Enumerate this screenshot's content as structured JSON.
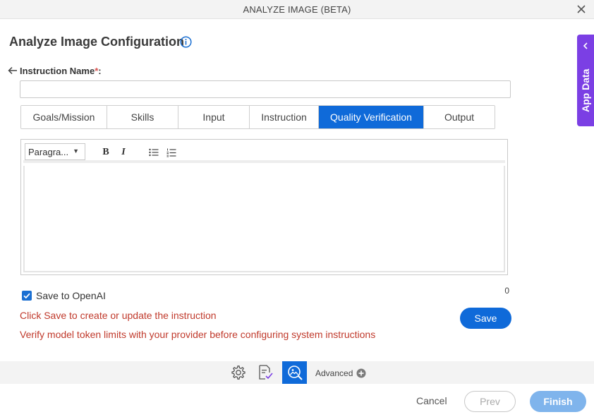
{
  "window": {
    "title": "ANALYZE IMAGE (BETA)"
  },
  "page": {
    "heading": "Analyze Image Configuration"
  },
  "form": {
    "instruction_label": "Instruction Name",
    "required_mark": "*",
    "label_suffix": ":",
    "instruction_value": ""
  },
  "tabs": [
    {
      "label": "Goals/Mission"
    },
    {
      "label": "Skills"
    },
    {
      "label": "Input"
    },
    {
      "label": "Instruction"
    },
    {
      "label": "Quality Verification",
      "active": true
    },
    {
      "label": "Output"
    }
  ],
  "editor": {
    "paragraph_select": "Paragra...",
    "bold": "B",
    "italic": "I",
    "char_count": "0"
  },
  "options": {
    "save_to_openai_label": "Save to OpenAI",
    "save_to_openai_checked": true
  },
  "messages": {
    "save_hint": "Click Save to create or update the instruction",
    "token_hint": "Verify model token limits with your provider before configuring system instructions"
  },
  "buttons": {
    "save": "Save",
    "cancel": "Cancel",
    "prev": "Prev",
    "finish": "Finish"
  },
  "bottom_toolbar": {
    "advanced_label": "Advanced"
  },
  "side_panel": {
    "label": "App Data"
  },
  "colors": {
    "primary": "#0f6ad9",
    "error_text": "#c0392b",
    "side_panel": "#7b3fe4",
    "finish_disabled": "#7fb4ec"
  }
}
